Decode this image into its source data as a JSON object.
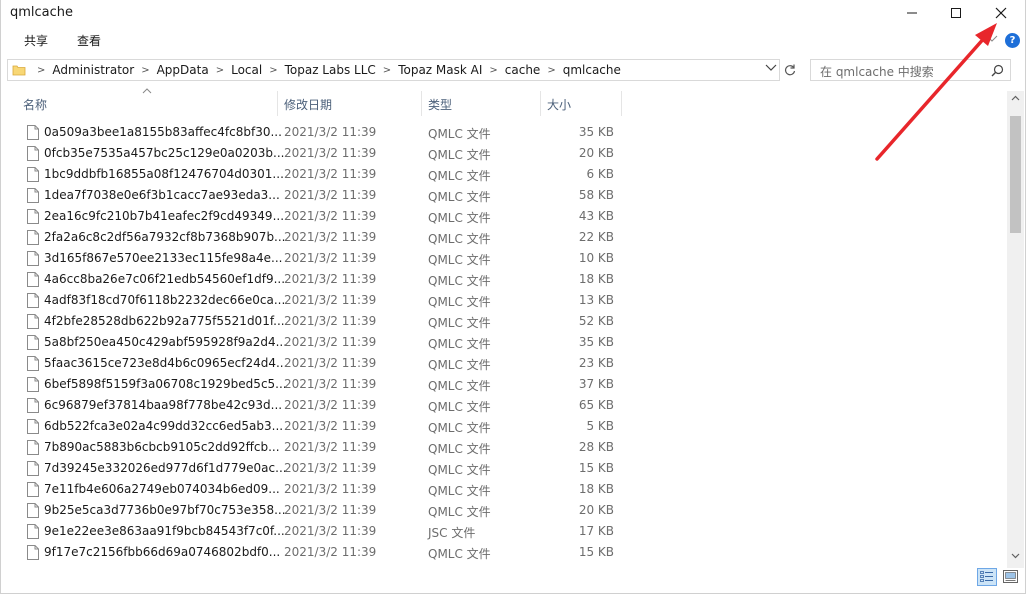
{
  "window": {
    "title": "qmlcache"
  },
  "ribbon": {
    "tabs": [
      "共享",
      "查看"
    ]
  },
  "address": {
    "breadcrumbs": [
      "Administrator",
      "AppData",
      "Local",
      "Topaz Labs LLC",
      "Topaz Mask AI",
      "cache",
      "qmlcache"
    ]
  },
  "search": {
    "placeholder": "在 qmlcache 中搜索"
  },
  "columns": {
    "name": "名称",
    "date": "修改日期",
    "type": "类型",
    "size": "大小"
  },
  "files": [
    {
      "name": "0a509a3bee1a8155b83affec4fc8bf30...",
      "date": "2021/3/2 11:39",
      "type": "QMLC 文件",
      "size": "35 KB"
    },
    {
      "name": "0fcb35e7535a457bc25c129e0a0203b...",
      "date": "2021/3/2 11:39",
      "type": "QMLC 文件",
      "size": "20 KB"
    },
    {
      "name": "1bc9ddbfb16855a08f12476704d0301...",
      "date": "2021/3/2 11:39",
      "type": "QMLC 文件",
      "size": "6 KB"
    },
    {
      "name": "1dea7f7038e0e6f3b1cacc7ae93eda3...",
      "date": "2021/3/2 11:39",
      "type": "QMLC 文件",
      "size": "58 KB"
    },
    {
      "name": "2ea16c9fc210b7b41eafec2f9cd49349...",
      "date": "2021/3/2 11:39",
      "type": "QMLC 文件",
      "size": "43 KB"
    },
    {
      "name": "2fa2a6c8c2df56a7932cf8b7368b907b...",
      "date": "2021/3/2 11:39",
      "type": "QMLC 文件",
      "size": "22 KB"
    },
    {
      "name": "3d165f867e570ee2133ec115fe98a4e...",
      "date": "2021/3/2 11:39",
      "type": "QMLC 文件",
      "size": "10 KB"
    },
    {
      "name": "4a6cc8ba26e7c06f21edb54560ef1df9...",
      "date": "2021/3/2 11:39",
      "type": "QMLC 文件",
      "size": "18 KB"
    },
    {
      "name": "4adf83f18cd70f6118b2232dec66e0ca...",
      "date": "2021/3/2 11:39",
      "type": "QMLC 文件",
      "size": "13 KB"
    },
    {
      "name": "4f2bfe28528db622b92a775f5521d01f...",
      "date": "2021/3/2 11:39",
      "type": "QMLC 文件",
      "size": "52 KB"
    },
    {
      "name": "5a8bf250ea450c429abf595928f9a2d4...",
      "date": "2021/3/2 11:39",
      "type": "QMLC 文件",
      "size": "35 KB"
    },
    {
      "name": "5faac3615ce723e8d4b6c0965ecf24d4...",
      "date": "2021/3/2 11:39",
      "type": "QMLC 文件",
      "size": "23 KB"
    },
    {
      "name": "6bef5898f5159f3a06708c1929bed5c5...",
      "date": "2021/3/2 11:39",
      "type": "QMLC 文件",
      "size": "37 KB"
    },
    {
      "name": "6c96879ef37814baa98f778be42c93d...",
      "date": "2021/3/2 11:39",
      "type": "QMLC 文件",
      "size": "65 KB"
    },
    {
      "name": "6db522fca3e02a4c99dd32cc6ed5ab3...",
      "date": "2021/3/2 11:39",
      "type": "QMLC 文件",
      "size": "5 KB"
    },
    {
      "name": "7b890ac5883b6cbcb9105c2dd92ffcb...",
      "date": "2021/3/2 11:39",
      "type": "QMLC 文件",
      "size": "28 KB"
    },
    {
      "name": "7d39245e332026ed977d6f1d779e0ac...",
      "date": "2021/3/2 11:39",
      "type": "QMLC 文件",
      "size": "15 KB"
    },
    {
      "name": "7e11fb4e606a2749eb074034b6ed09...",
      "date": "2021/3/2 11:39",
      "type": "QMLC 文件",
      "size": "18 KB"
    },
    {
      "name": "9b25e5ca3d7736b0e97bf70c753e358...",
      "date": "2021/3/2 11:39",
      "type": "QMLC 文件",
      "size": "20 KB"
    },
    {
      "name": "9e1e22ee3e863aa91f9bcb84543f7c0f...",
      "date": "2021/3/2 11:39",
      "type": "JSC 文件",
      "size": "17 KB"
    },
    {
      "name": "9f17e7c2156fbb66d69a0746802bdf0...",
      "date": "2021/3/2 11:39",
      "type": "QMLC 文件",
      "size": "15 KB"
    }
  ],
  "icons": {
    "minimize": "minimize-icon",
    "maximize": "maximize-icon",
    "close": "close-icon",
    "folder": "folder-icon",
    "refresh": "refresh-icon",
    "search": "search-icon",
    "file": "file-icon"
  },
  "colors": {
    "annotation_arrow": "#e8262b",
    "selected_view": "#cce4f7",
    "help_badge": "#1e6fd8",
    "column_header_text": "#4c607a"
  }
}
